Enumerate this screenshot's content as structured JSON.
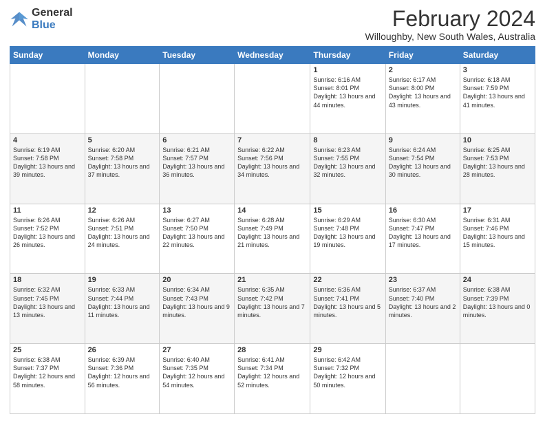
{
  "logo": {
    "general": "General",
    "blue": "Blue"
  },
  "title": "February 2024",
  "subtitle": "Willoughby, New South Wales, Australia",
  "columns": [
    "Sunday",
    "Monday",
    "Tuesday",
    "Wednesday",
    "Thursday",
    "Friday",
    "Saturday"
  ],
  "weeks": [
    [
      {
        "day": "",
        "info": ""
      },
      {
        "day": "",
        "info": ""
      },
      {
        "day": "",
        "info": ""
      },
      {
        "day": "",
        "info": ""
      },
      {
        "day": "1",
        "info": "Sunrise: 6:16 AM\nSunset: 8:01 PM\nDaylight: 13 hours and 44 minutes."
      },
      {
        "day": "2",
        "info": "Sunrise: 6:17 AM\nSunset: 8:00 PM\nDaylight: 13 hours and 43 minutes."
      },
      {
        "day": "3",
        "info": "Sunrise: 6:18 AM\nSunset: 7:59 PM\nDaylight: 13 hours and 41 minutes."
      }
    ],
    [
      {
        "day": "4",
        "info": "Sunrise: 6:19 AM\nSunset: 7:58 PM\nDaylight: 13 hours and 39 minutes."
      },
      {
        "day": "5",
        "info": "Sunrise: 6:20 AM\nSunset: 7:58 PM\nDaylight: 13 hours and 37 minutes."
      },
      {
        "day": "6",
        "info": "Sunrise: 6:21 AM\nSunset: 7:57 PM\nDaylight: 13 hours and 36 minutes."
      },
      {
        "day": "7",
        "info": "Sunrise: 6:22 AM\nSunset: 7:56 PM\nDaylight: 13 hours and 34 minutes."
      },
      {
        "day": "8",
        "info": "Sunrise: 6:23 AM\nSunset: 7:55 PM\nDaylight: 13 hours and 32 minutes."
      },
      {
        "day": "9",
        "info": "Sunrise: 6:24 AM\nSunset: 7:54 PM\nDaylight: 13 hours and 30 minutes."
      },
      {
        "day": "10",
        "info": "Sunrise: 6:25 AM\nSunset: 7:53 PM\nDaylight: 13 hours and 28 minutes."
      }
    ],
    [
      {
        "day": "11",
        "info": "Sunrise: 6:26 AM\nSunset: 7:52 PM\nDaylight: 13 hours and 26 minutes."
      },
      {
        "day": "12",
        "info": "Sunrise: 6:26 AM\nSunset: 7:51 PM\nDaylight: 13 hours and 24 minutes."
      },
      {
        "day": "13",
        "info": "Sunrise: 6:27 AM\nSunset: 7:50 PM\nDaylight: 13 hours and 22 minutes."
      },
      {
        "day": "14",
        "info": "Sunrise: 6:28 AM\nSunset: 7:49 PM\nDaylight: 13 hours and 21 minutes."
      },
      {
        "day": "15",
        "info": "Sunrise: 6:29 AM\nSunset: 7:48 PM\nDaylight: 13 hours and 19 minutes."
      },
      {
        "day": "16",
        "info": "Sunrise: 6:30 AM\nSunset: 7:47 PM\nDaylight: 13 hours and 17 minutes."
      },
      {
        "day": "17",
        "info": "Sunrise: 6:31 AM\nSunset: 7:46 PM\nDaylight: 13 hours and 15 minutes."
      }
    ],
    [
      {
        "day": "18",
        "info": "Sunrise: 6:32 AM\nSunset: 7:45 PM\nDaylight: 13 hours and 13 minutes."
      },
      {
        "day": "19",
        "info": "Sunrise: 6:33 AM\nSunset: 7:44 PM\nDaylight: 13 hours and 11 minutes."
      },
      {
        "day": "20",
        "info": "Sunrise: 6:34 AM\nSunset: 7:43 PM\nDaylight: 13 hours and 9 minutes."
      },
      {
        "day": "21",
        "info": "Sunrise: 6:35 AM\nSunset: 7:42 PM\nDaylight: 13 hours and 7 minutes."
      },
      {
        "day": "22",
        "info": "Sunrise: 6:36 AM\nSunset: 7:41 PM\nDaylight: 13 hours and 5 minutes."
      },
      {
        "day": "23",
        "info": "Sunrise: 6:37 AM\nSunset: 7:40 PM\nDaylight: 13 hours and 2 minutes."
      },
      {
        "day": "24",
        "info": "Sunrise: 6:38 AM\nSunset: 7:39 PM\nDaylight: 13 hours and 0 minutes."
      }
    ],
    [
      {
        "day": "25",
        "info": "Sunrise: 6:38 AM\nSunset: 7:37 PM\nDaylight: 12 hours and 58 minutes."
      },
      {
        "day": "26",
        "info": "Sunrise: 6:39 AM\nSunset: 7:36 PM\nDaylight: 12 hours and 56 minutes."
      },
      {
        "day": "27",
        "info": "Sunrise: 6:40 AM\nSunset: 7:35 PM\nDaylight: 12 hours and 54 minutes."
      },
      {
        "day": "28",
        "info": "Sunrise: 6:41 AM\nSunset: 7:34 PM\nDaylight: 12 hours and 52 minutes."
      },
      {
        "day": "29",
        "info": "Sunrise: 6:42 AM\nSunset: 7:32 PM\nDaylight: 12 hours and 50 minutes."
      },
      {
        "day": "",
        "info": ""
      },
      {
        "day": "",
        "info": ""
      }
    ]
  ]
}
